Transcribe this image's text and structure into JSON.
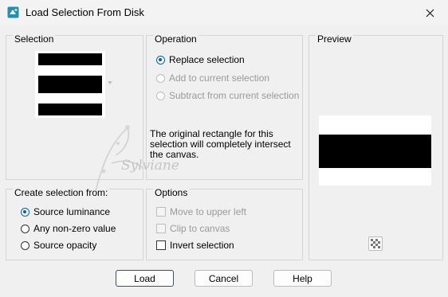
{
  "window": {
    "title": "Load Selection From Disk"
  },
  "selection_group": {
    "title": "Selection"
  },
  "operation_group": {
    "title": "Operation",
    "options": [
      {
        "label": "Replace selection",
        "checked": true,
        "enabled": true
      },
      {
        "label": "Add to current selection",
        "checked": false,
        "enabled": false
      },
      {
        "label": "Subtract from current selection",
        "checked": false,
        "enabled": false
      }
    ],
    "note": "The original rectangle for this selection will completely intersect the canvas."
  },
  "preview_group": {
    "title": "Preview"
  },
  "create_group": {
    "title": "Create selection from:",
    "options": [
      {
        "label": "Source luminance",
        "checked": true
      },
      {
        "label": "Any non-zero value",
        "checked": false
      },
      {
        "label": "Source opacity",
        "checked": false
      }
    ]
  },
  "options_group": {
    "title": "Options",
    "items": [
      {
        "label": "Move to upper left",
        "checked": false,
        "enabled": false
      },
      {
        "label": "Clip to canvas",
        "checked": false,
        "enabled": false
      },
      {
        "label": "Invert selection",
        "checked": false,
        "enabled": true
      }
    ]
  },
  "buttons": {
    "load": "Load",
    "cancel": "Cancel",
    "help": "Help"
  },
  "watermark": {
    "text": "Sylviane"
  },
  "colors": {
    "accent": "#005fb8",
    "bar": "#000000",
    "thumb_bg": "#ffffff"
  }
}
